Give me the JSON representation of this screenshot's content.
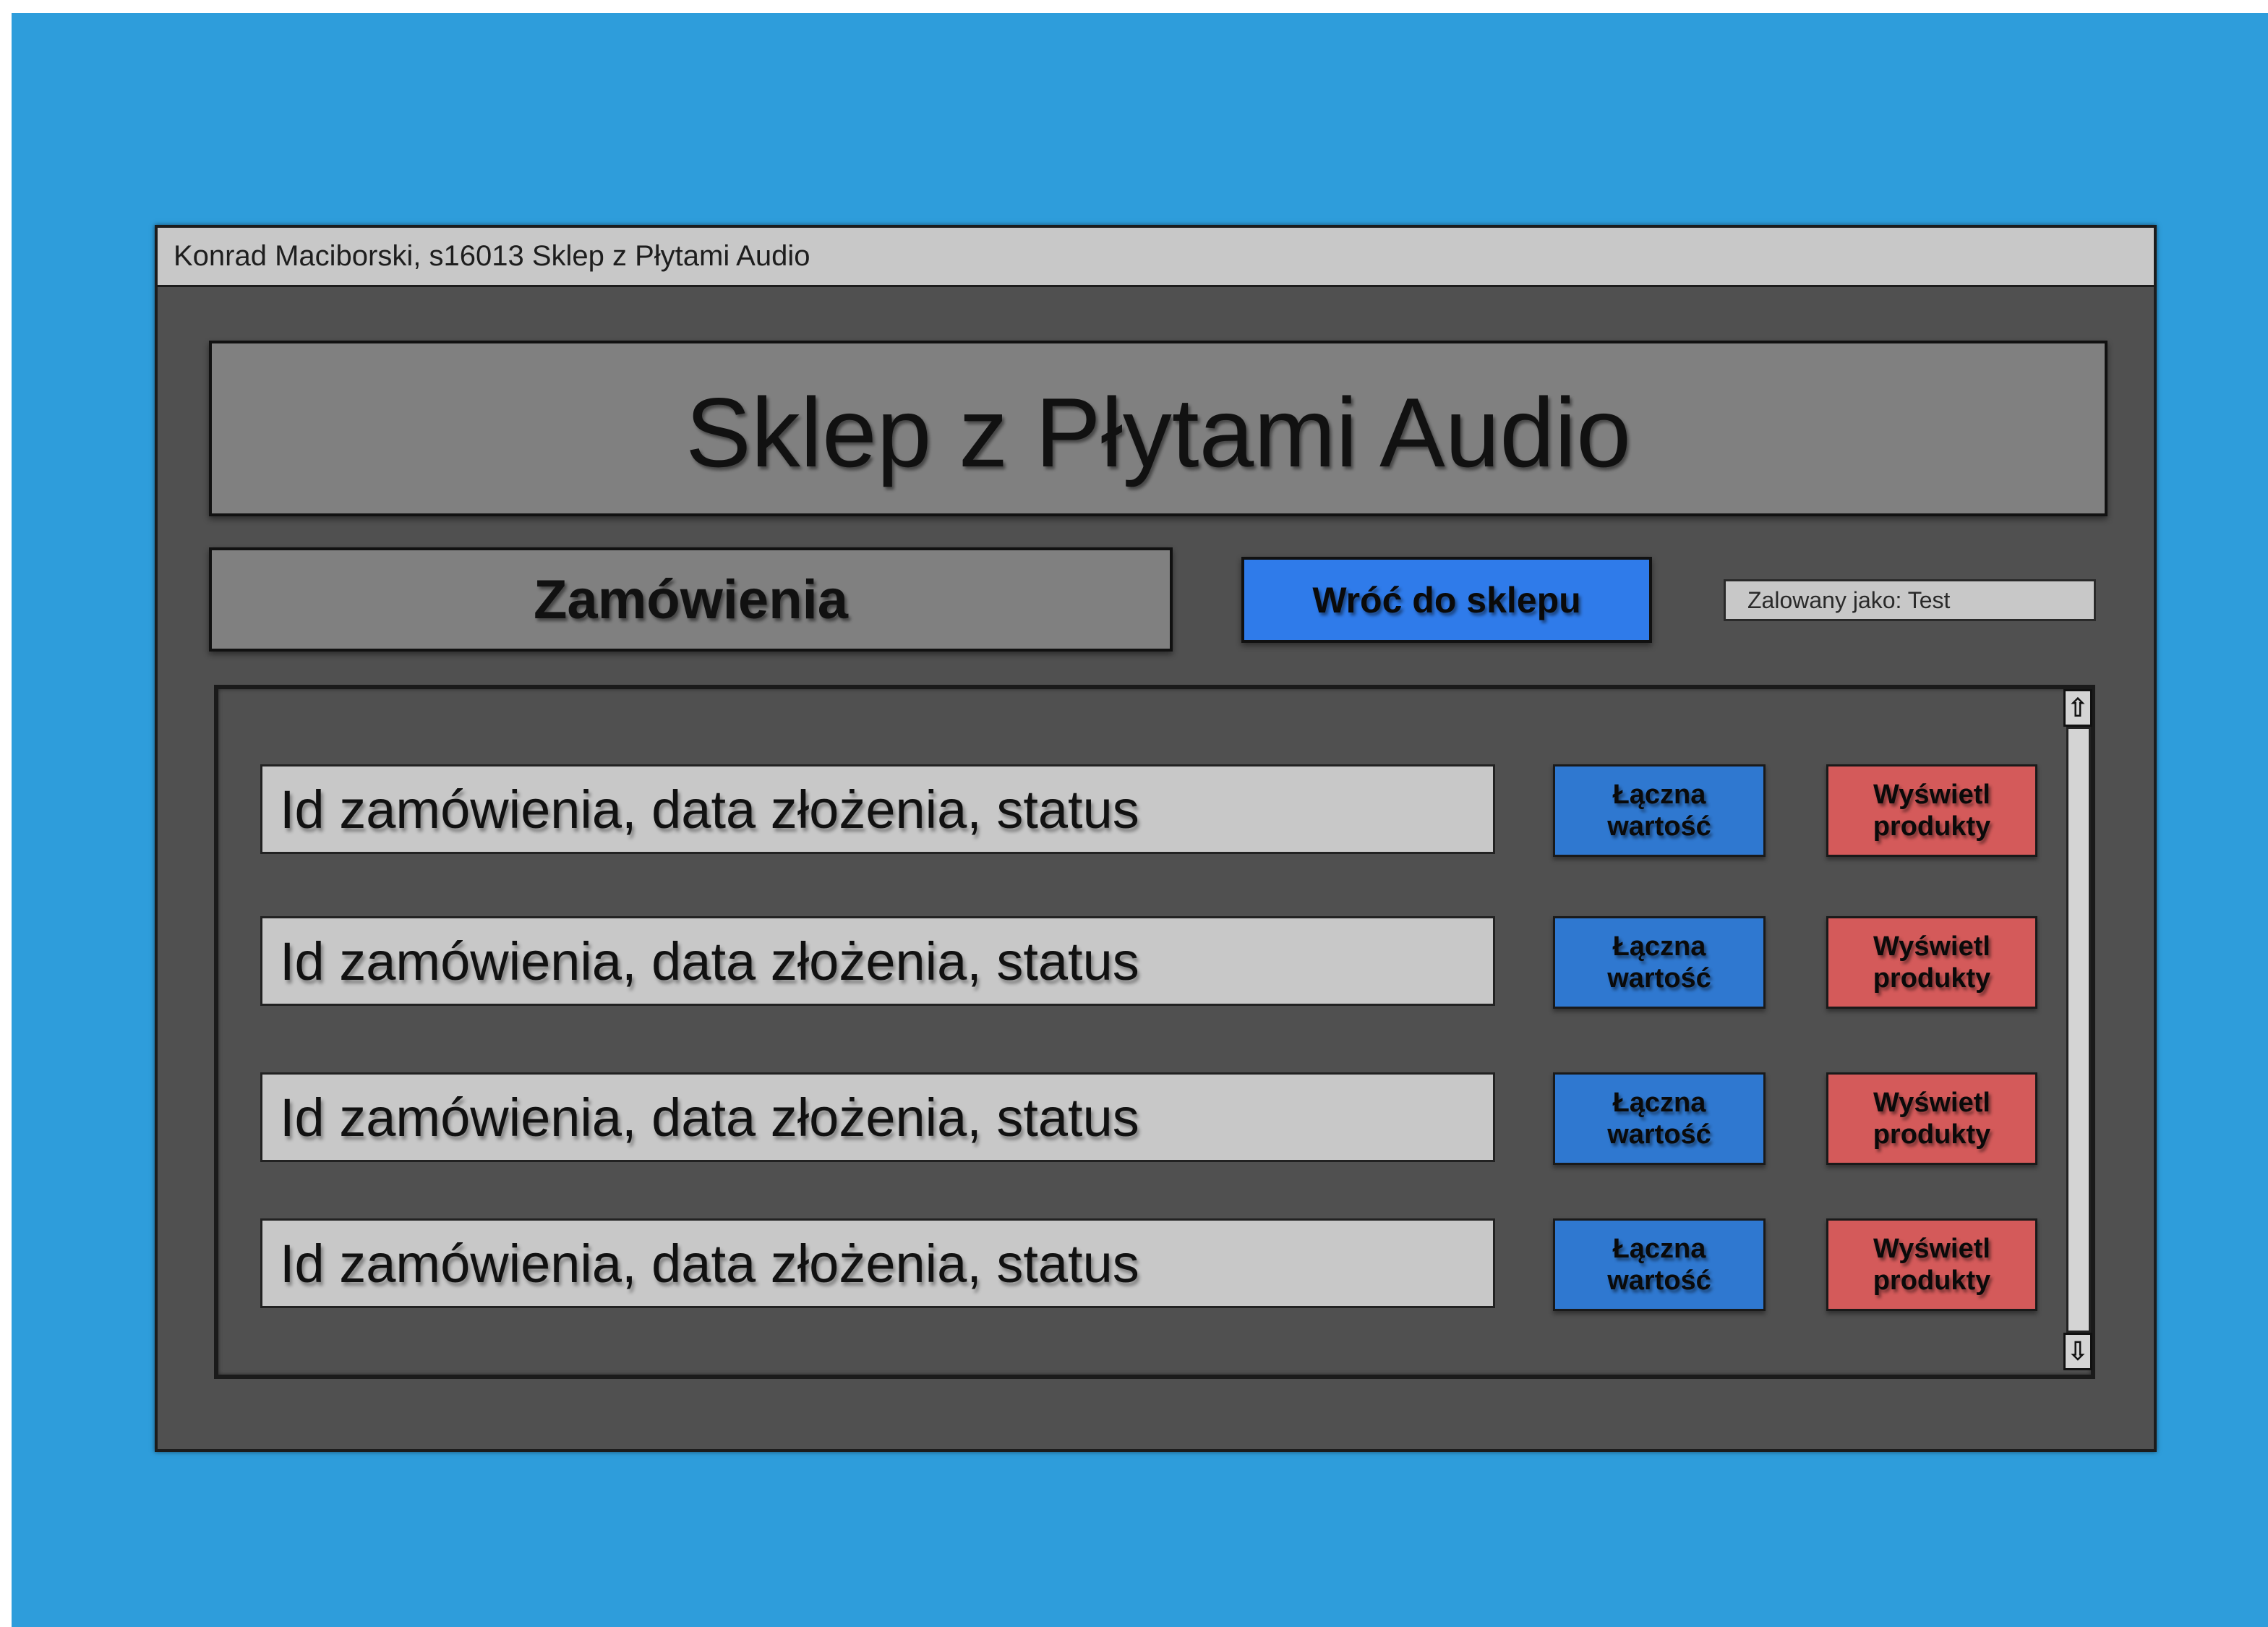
{
  "window": {
    "title": "Konrad Maciborski, s16013 Sklep z Płytami Audio"
  },
  "header": {
    "app_name": "Sklep z Płytami Audio"
  },
  "toolbar": {
    "section_title": "Zamówienia",
    "back_button_label": "Wróć do sklepu",
    "logged_in_text": "Zalowany jako: Test"
  },
  "orders": {
    "rows": [
      {
        "label": "Id zamówienia, data złożenia, status",
        "total_button": "Łączna\nwartość",
        "products_button": "Wyświetl\nprodukty"
      },
      {
        "label": "Id zamówienia, data złożenia, status",
        "total_button": "Łączna\nwartość",
        "products_button": "Wyświetl\nprodukty"
      },
      {
        "label": "Id zamówienia, data złożenia, status",
        "total_button": "Łączna\nwartość",
        "products_button": "Wyświetl\nprodukty"
      },
      {
        "label": "Id zamówienia, data złożenia, status",
        "total_button": "Łączna\nwartość",
        "products_button": "Wyświetl\nprodukty"
      }
    ]
  },
  "scrollbar": {
    "up_icon": "arrow-up-icon",
    "down_icon": "arrow-down-icon"
  },
  "colors": {
    "background": "#2e9ddb",
    "window": "#505050",
    "primary_button": "#2f7bea",
    "danger_button": "#d45a5a"
  }
}
